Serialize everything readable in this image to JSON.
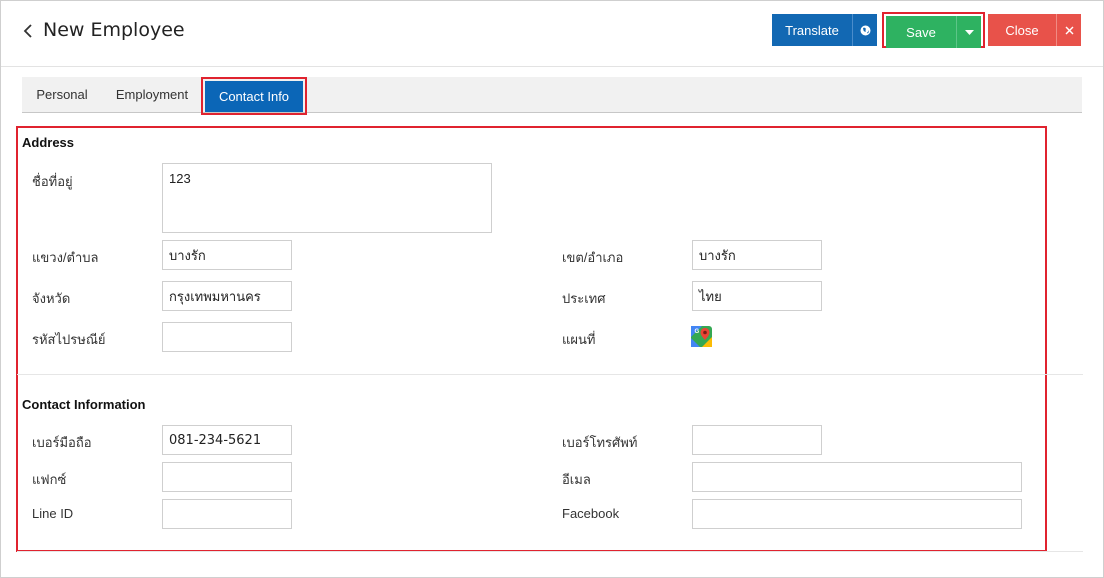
{
  "header": {
    "title": "New Employee",
    "translate_label": "Translate",
    "save_label": "Save",
    "close_label": "Close"
  },
  "tabs": [
    {
      "label": "Personal"
    },
    {
      "label": "Employment"
    },
    {
      "label": "Contact Info",
      "active": true
    }
  ],
  "address": {
    "section_title": "Address",
    "address_label": "ชื่อที่อยู่",
    "address_value": "123",
    "subdistrict_label": "แขวง/ตำบล",
    "subdistrict_value": "บางรัก",
    "district_label": "เขต/อำเภอ",
    "district_value": "บางรัก",
    "province_label": "จังหวัด",
    "province_value": "กรุงเทพมหานคร",
    "country_label": "ประเทศ",
    "country_value": "ไทย",
    "postal_label": "รหัสไปรษณีย์",
    "postal_value": "",
    "map_label": "แผนที่",
    "map_icon": "google-maps-icon"
  },
  "contact": {
    "section_title": "Contact Information",
    "mobile_label": "เบอร์มือถือ",
    "mobile_value": "081-234-5621",
    "phone_label": "เบอร์โทรศัพท์",
    "phone_value": "",
    "fax_label": "แฟกซ์",
    "fax_value": "",
    "email_label": "อีเมล",
    "email_value": "",
    "line_label": "Line ID",
    "line_value": "",
    "facebook_label": "Facebook",
    "facebook_value": ""
  },
  "colors": {
    "primary": "#1268b3",
    "success": "#2eb261",
    "danger": "#e8524a",
    "highlight": "#e0232f"
  }
}
